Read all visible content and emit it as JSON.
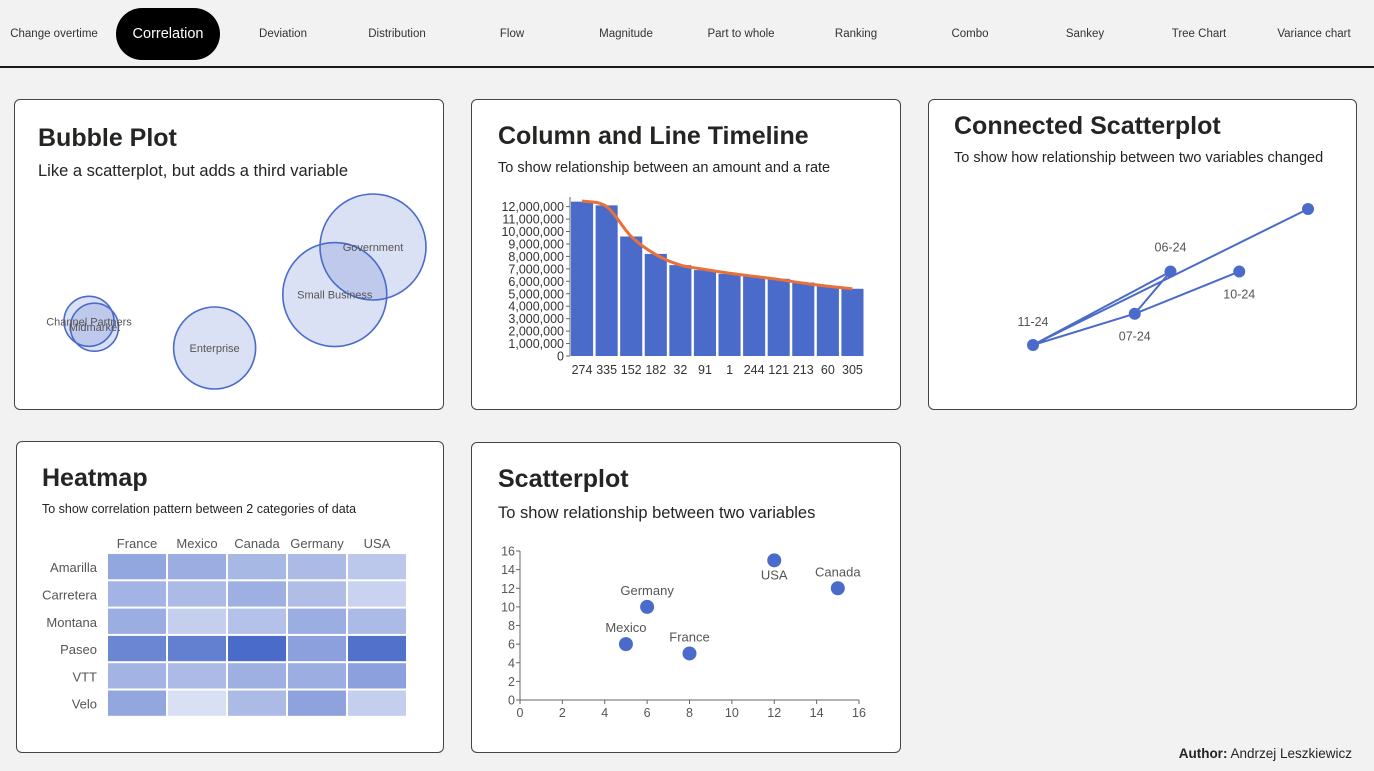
{
  "nav": {
    "items": [
      {
        "label": "Change over time",
        "lines": [
          "Change over",
          "time"
        ],
        "active": false
      },
      {
        "label": "Correlation",
        "lines": [
          "Correlation"
        ],
        "active": true
      },
      {
        "label": "Deviation",
        "lines": [
          "Deviation"
        ],
        "active": false
      },
      {
        "label": "Distribution",
        "lines": [
          "Distribution"
        ],
        "active": false
      },
      {
        "label": "Flow",
        "lines": [
          "Flow"
        ],
        "active": false
      },
      {
        "label": "Magnitude",
        "lines": [
          "Magnitude"
        ],
        "active": false
      },
      {
        "label": "Part to whole",
        "lines": [
          "Part to whole"
        ],
        "active": false
      },
      {
        "label": "Ranking",
        "lines": [
          "Ranking"
        ],
        "active": false
      },
      {
        "label": "Combo",
        "lines": [
          "Combo"
        ],
        "active": false
      },
      {
        "label": "Sankey",
        "lines": [
          "Sankey"
        ],
        "active": false
      },
      {
        "label": "Tree Chart",
        "lines": [
          "Tree Chart"
        ],
        "active": false
      },
      {
        "label": "Variance chart",
        "lines": [
          "Variance chart"
        ],
        "active": false
      }
    ]
  },
  "colors": {
    "accent": "#4a6bc9",
    "line": "#e8703a",
    "nav_active_bg": "#000000",
    "background": "#f2f2f2"
  },
  "cards": {
    "bubble": {
      "title": "Bubble Plot",
      "subtitle": "Like a scatterplot, but adds a third variable"
    },
    "column_line": {
      "title": "Column and Line Timeline",
      "subtitle": "To show relationship between an amount and a rate"
    },
    "connected": {
      "title": "Connected Scatterplot",
      "subtitle": "To show how relationship between two variables changed"
    },
    "heatmap": {
      "title": "Heatmap",
      "subtitle": "To show correlation pattern between 2 categories of data"
    },
    "scatter": {
      "title": "Scatterplot",
      "subtitle": "To show relationship between two variables"
    }
  },
  "author": {
    "label": "Author:",
    "name": "Andrzej Leszkiewicz"
  },
  "chart_data": [
    {
      "id": "bubble",
      "type": "scatter",
      "title": "Bubble Plot",
      "subtitle": "Like a scatterplot, but adds a third variable",
      "axes_visible": false,
      "points": [
        {
          "label": "Channel Partners",
          "x": 0.9,
          "y": 3.5,
          "size": 25
        },
        {
          "label": "Midmarket",
          "x": 1.0,
          "y": 3.3,
          "size": 24
        },
        {
          "label": "Enterprise",
          "x": 3.2,
          "y": 2.6,
          "size": 41
        },
        {
          "label": "Small Business",
          "x": 5.4,
          "y": 4.4,
          "size": 52
        },
        {
          "label": "Government",
          "x": 6.1,
          "y": 6.0,
          "size": 53
        }
      ]
    },
    {
      "id": "column_line",
      "type": "bar",
      "title": "Column and Line Timeline",
      "subtitle": "To show relationship between an amount and a rate",
      "categories": [
        "274",
        "335",
        "152",
        "182",
        "32",
        "91",
        "1",
        "244",
        "121",
        "213",
        "60",
        "305"
      ],
      "series": [
        {
          "kind": "bar",
          "values": [
            12400000,
            12100000,
            9600000,
            8200000,
            7300000,
            6900000,
            6600000,
            6400000,
            6200000,
            5900000,
            5600000,
            5400000
          ]
        },
        {
          "kind": "line",
          "values": [
            12450000,
            12000000,
            9600000,
            8150000,
            7300000,
            6950000,
            6650000,
            6400000,
            6150000,
            5850000,
            5600000,
            5400000
          ]
        }
      ],
      "y_ticks": [
        "12,000,000",
        "11,000,000",
        "10,000,000",
        "9,000,000",
        "8,000,000",
        "7,000,000",
        "6,000,000",
        "5,000,000",
        "4,000,000",
        "3,000,000",
        "2,000,000",
        "1,000,000",
        "0"
      ],
      "ylim": [
        0,
        12450000
      ]
    },
    {
      "id": "connected",
      "type": "line",
      "title": "Connected Scatterplot",
      "subtitle": "To show how relationship between two variables changed",
      "axes_visible": false,
      "points": [
        {
          "label": "11-24",
          "x": 0.0,
          "y": 0.0
        },
        {
          "label": "06-24",
          "x": 0.5,
          "y": 0.54
        },
        {
          "label": "07-24",
          "x": 0.37,
          "y": 0.23
        },
        {
          "label": "10-24",
          "x": 0.75,
          "y": 0.54
        },
        {
          "label": "",
          "x": 1.0,
          "y": 1.0
        }
      ],
      "path_order": [
        0,
        1,
        2,
        3,
        2,
        0,
        4
      ]
    },
    {
      "id": "heatmap",
      "type": "heatmap",
      "title": "Heatmap",
      "subtitle": "To show correlation pattern between 2 categories of data",
      "columns": [
        "France",
        "Mexico",
        "Canada",
        "Germany",
        "USA"
      ],
      "rows": [
        "Amarilla",
        "Carretera",
        "Montana",
        "Paseo",
        "VTT",
        "Velo"
      ],
      "values": [
        [
          0.55,
          0.5,
          0.42,
          0.4,
          0.3
        ],
        [
          0.45,
          0.4,
          0.48,
          0.38,
          0.22
        ],
        [
          0.5,
          0.25,
          0.35,
          0.5,
          0.4
        ],
        [
          0.8,
          0.85,
          1.0,
          0.6,
          0.95
        ],
        [
          0.45,
          0.4,
          0.48,
          0.5,
          0.6
        ],
        [
          0.55,
          0.12,
          0.4,
          0.58,
          0.25
        ]
      ]
    },
    {
      "id": "scatter",
      "type": "scatter",
      "title": "Scatterplot",
      "subtitle": "To show relationship between two variables",
      "points": [
        {
          "label": "France",
          "x": 8,
          "y": 5
        },
        {
          "label": "Mexico",
          "x": 5,
          "y": 6
        },
        {
          "label": "Germany",
          "x": 6,
          "y": 10
        },
        {
          "label": "USA",
          "x": 12,
          "y": 15
        },
        {
          "label": "Canada",
          "x": 15,
          "y": 12
        }
      ],
      "xlim": [
        0,
        16
      ],
      "ylim": [
        0,
        16
      ],
      "x_ticks": [
        "0",
        "2",
        "4",
        "6",
        "8",
        "10",
        "12",
        "14",
        "16"
      ],
      "y_ticks": [
        "0",
        "2",
        "4",
        "6",
        "8",
        "10",
        "12",
        "14",
        "16"
      ]
    }
  ]
}
